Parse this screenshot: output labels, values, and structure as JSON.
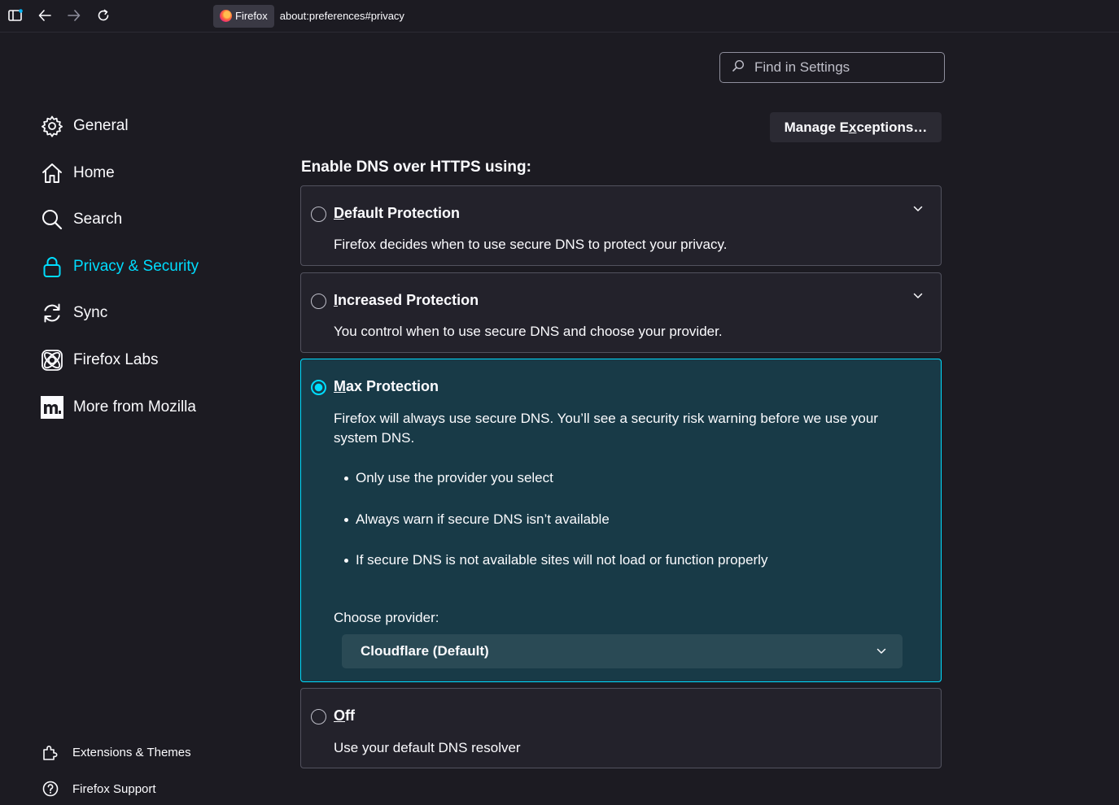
{
  "toolbar": {
    "identity_label": "Firefox",
    "url": "about:preferences#privacy"
  },
  "sidebar": {
    "items": [
      {
        "label": "General",
        "icon": "gear-icon"
      },
      {
        "label": "Home",
        "icon": "home-icon"
      },
      {
        "label": "Search",
        "icon": "search-icon"
      },
      {
        "label": "Privacy & Security",
        "icon": "lock-icon",
        "selected": true
      },
      {
        "label": "Sync",
        "icon": "sync-icon"
      },
      {
        "label": "Firefox Labs",
        "icon": "atom-icon"
      },
      {
        "label": "More from Mozilla",
        "icon": "mozilla-logo-icon"
      }
    ],
    "footer": [
      {
        "label": "Extensions & Themes",
        "icon": "puzzle-icon"
      },
      {
        "label": "Firefox Support",
        "icon": "help-icon"
      }
    ]
  },
  "search": {
    "placeholder": "Find in Settings"
  },
  "manage_exceptions": {
    "label_pre": "Manage E",
    "label_key": "x",
    "label_post": "ceptions…"
  },
  "dns": {
    "heading": "Enable DNS over HTTPS using:",
    "options": [
      {
        "key": "D",
        "rest": "efault Protection",
        "desc": "Firefox decides when to use secure DNS to protect your privacy.",
        "checked": false
      },
      {
        "key": "I",
        "rest": "ncreased Protection",
        "desc": "You control when to use secure DNS and choose your provider.",
        "checked": false
      },
      {
        "key": "M",
        "rest": "ax Protection",
        "desc": "Firefox will always use secure DNS. You’ll see a security risk warning before we use your system DNS.",
        "checked": true
      },
      {
        "key": "O",
        "rest": "ff",
        "desc": "Use your default DNS resolver",
        "checked": false
      }
    ],
    "max_bullets": [
      "Only use the provider you select",
      "Always warn if secure DNS isn’t available",
      "If secure DNS is not available sites will not load or function properly"
    ],
    "provider_label": "Choose provider:",
    "provider_value": "Cloudflare (Default)"
  },
  "colors": {
    "accent": "#00ddff",
    "background": "#1c1b22",
    "card": "#23222b",
    "active_card": "#183a47"
  }
}
